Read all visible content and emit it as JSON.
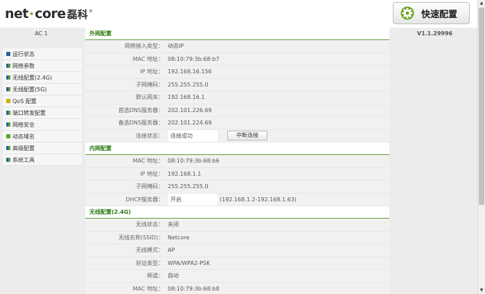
{
  "header": {
    "logo_text_en_1": "net",
    "logo_dot": "·",
    "logo_text_en_2": "core",
    "logo_text_cn": "磊科",
    "logo_reg": "®",
    "quick_button_label": "快速配置",
    "quick_button_icon": "gear-icon"
  },
  "sidebar": {
    "ac_label": "AC 1",
    "items": [
      {
        "label": "运行状态",
        "icon": "blue"
      },
      {
        "label": "网络参数",
        "icon": "multi"
      },
      {
        "label": "无线配置(2.4G)",
        "icon": "multi"
      },
      {
        "label": "无线配置(5G)",
        "icon": "multi"
      },
      {
        "label": "QoS 配置",
        "icon": "yellow"
      },
      {
        "label": "端口转发配置",
        "icon": "multi"
      },
      {
        "label": "网络安全",
        "icon": "multi"
      },
      {
        "label": "动态域名",
        "icon": "green"
      },
      {
        "label": "高级配置",
        "icon": "multi"
      },
      {
        "label": "系统工具",
        "icon": "multi"
      }
    ]
  },
  "version": "V1.1.29996",
  "sections": {
    "wan": {
      "title": "外网配置",
      "rows": [
        {
          "k": "网络接入类型：",
          "v": "动态IP"
        },
        {
          "k": "MAC 地址：",
          "v": "08:10:79:3b:68:b7"
        },
        {
          "k": "IP 地址：",
          "v": "192.168.16.156"
        },
        {
          "k": "子网掩码：",
          "v": "255.255.255.0"
        },
        {
          "k": "默认网关：",
          "v": "192.168.16.1"
        },
        {
          "k": "首选DNS服务器：",
          "v": "202.101.226.69"
        },
        {
          "k": "备选DNS服务器：",
          "v": "202.101.224.69"
        }
      ],
      "status_label": "连接状态：",
      "status_value": "连接成功",
      "disconnect_label": "中断连接"
    },
    "lan": {
      "title": "内网配置",
      "rows": [
        {
          "k": "MAC 地址：",
          "v": "08:10:79:3b:68:b6"
        },
        {
          "k": "IP 地址：",
          "v": "192.168.1.1"
        },
        {
          "k": "子网掩码：",
          "v": "255.255.255.0"
        }
      ],
      "dhcp_label": "DHCP服务器：",
      "dhcp_value": "开启",
      "dhcp_range": "(192.168.1.2-192.168.1.63)"
    },
    "wireless": {
      "title": "无线配置(2.4G)",
      "rows": [
        {
          "k": "无线状态：",
          "v": "关闭"
        },
        {
          "k": "无线名称(SSID)：",
          "v": "Netcore"
        },
        {
          "k": "无线模式：",
          "v": "AP"
        },
        {
          "k": "验证类型：",
          "v": "WPA/WPA2-PSK"
        },
        {
          "k": "频道：",
          "v": "自动"
        },
        {
          "k": "MAC 地址：",
          "v": "08:10:79:3b:68:b8"
        }
      ]
    }
  }
}
